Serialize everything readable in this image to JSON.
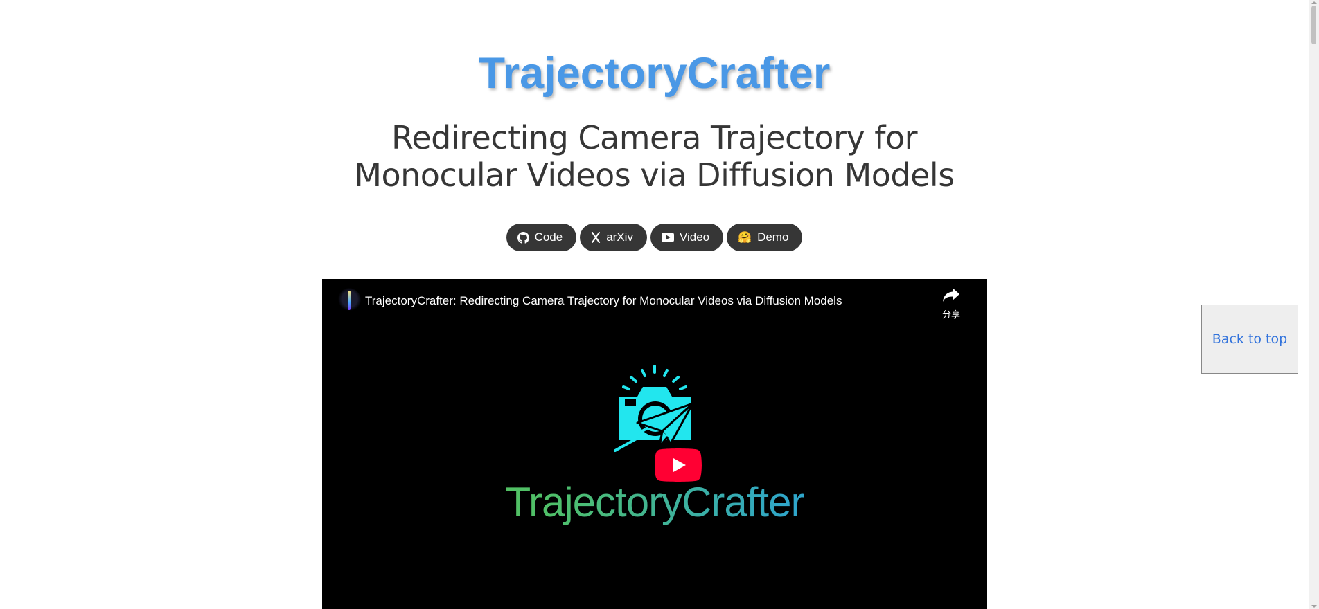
{
  "header": {
    "title": "TrajectoryCrafter",
    "subtitle_line1": "Redirecting Camera Trajectory for",
    "subtitle_line2": "Monocular Videos via Diffusion Models"
  },
  "buttons": [
    {
      "label": "Code",
      "icon": "github-icon"
    },
    {
      "label": "arXiv",
      "icon": "arxiv-icon"
    },
    {
      "label": "Video",
      "icon": "youtube-icon"
    },
    {
      "label": "Demo",
      "icon": "hugging-face-emoji-icon",
      "icon_glyph": "🤗"
    }
  ],
  "video": {
    "title": "TrajectoryCrafter: Redirecting Camera Trajectory for Monocular Videos via Diffusion Models",
    "share_label": "分享",
    "logo_text": "TrajectoryCrafter"
  },
  "back_to_top": {
    "label": "Back to top"
  },
  "colors": {
    "title": "#4a98e6",
    "button_bg": "#363636",
    "play_red": "#ff0033",
    "logo_cyan": "#22e6ee",
    "link": "#3273dc"
  }
}
